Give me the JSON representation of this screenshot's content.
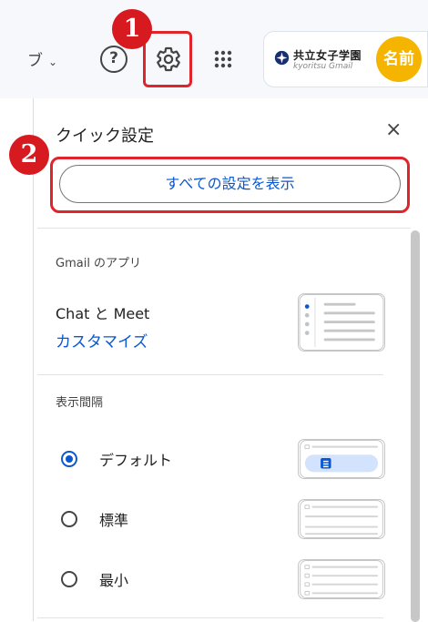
{
  "header": {
    "dropdown_partial": "ブ",
    "help_symbol": "?",
    "account": {
      "school_name": "共立女子学園",
      "school_sub": "kyoritsu Gmail",
      "avatar_text": "名前"
    }
  },
  "annotations": {
    "step1": "1",
    "step2": "2"
  },
  "quick_settings": {
    "title": "クイック設定",
    "close_symbol": "×",
    "all_settings_button": "すべての設定を表示",
    "apps_section": {
      "label": "Gmail のアプリ",
      "app_name": "Chat と Meet",
      "customize": "カスタマイズ"
    },
    "density_section": {
      "label": "表示間隔",
      "options": [
        {
          "label": "デフォルト",
          "selected": true
        },
        {
          "label": "標準",
          "selected": false
        },
        {
          "label": "最小",
          "selected": false
        }
      ]
    }
  },
  "colors": {
    "highlight_red": "#e0242c",
    "badge_red": "#d71920",
    "link_blue": "#0b57d0",
    "avatar_yellow": "#f4b400"
  }
}
